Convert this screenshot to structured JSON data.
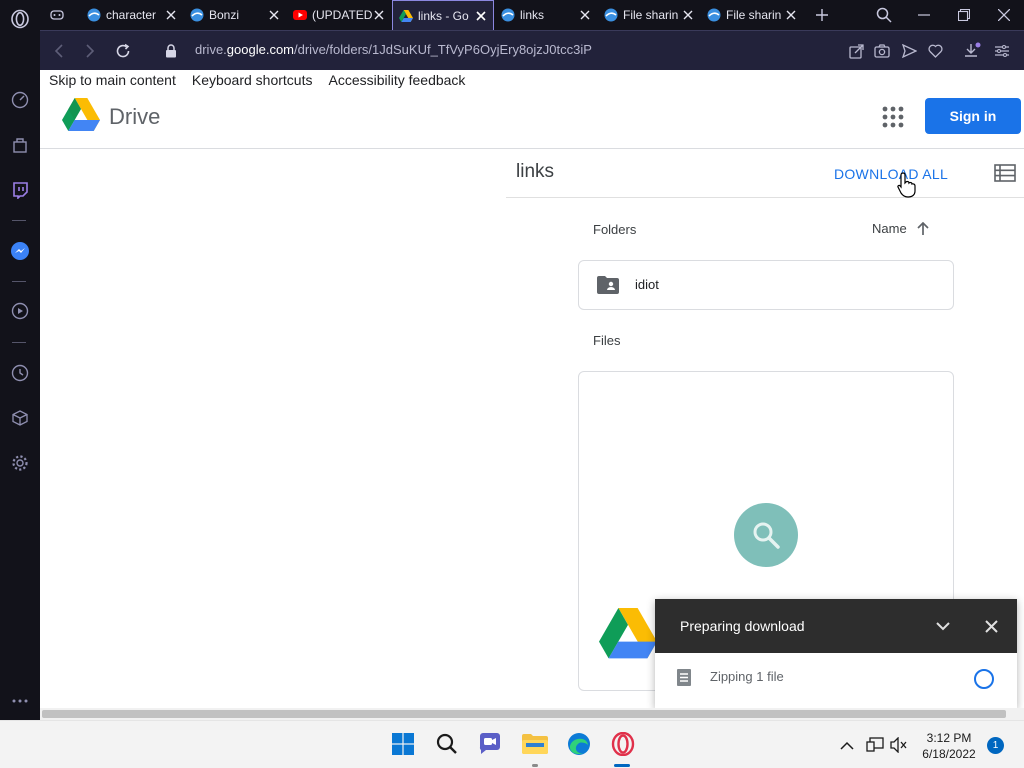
{
  "browser": {
    "tabs": [
      {
        "title": "",
        "favicon": "gamepad-icon"
      },
      {
        "title": "character",
        "favicon": "edge-wave-icon"
      },
      {
        "title": "Bonzi",
        "favicon": "edge-wave-icon"
      },
      {
        "title": "(UPDATED",
        "favicon": "youtube-icon"
      },
      {
        "title": "links - Go",
        "favicon": "google-drive-icon",
        "active": true
      },
      {
        "title": "links",
        "favicon": "edge-wave-icon"
      },
      {
        "title": "File sharin",
        "favicon": "edge-wave-icon"
      },
      {
        "title": "File sharin",
        "favicon": "edge-wave-icon"
      }
    ],
    "url_host_prefix": "drive.",
    "url_host": "google.com",
    "url_path": "/drive/folders/1JdSuKUf_TfVyP6OyjEry8ojzJ0tcc3iP"
  },
  "skip_links": [
    "Skip to main content",
    "Keyboard shortcuts",
    "Accessibility feedback"
  ],
  "drive": {
    "logo_text": "Drive",
    "signin_label": "Sign in",
    "folder_title": "links",
    "download_all_label": "DOWNLOAD ALL",
    "folders_label": "Folders",
    "sort_label": "Name",
    "folders": [
      {
        "name": "idiot"
      }
    ],
    "files_label": "Files"
  },
  "download_popup": {
    "title": "Preparing download",
    "status": "Zipping 1 file"
  },
  "taskbar": {
    "time": "3:12 PM",
    "date": "6/18/2022",
    "notification_count": "1"
  },
  "colors": {
    "accent": "#1a73e8",
    "browser_bg": "#12121a"
  }
}
